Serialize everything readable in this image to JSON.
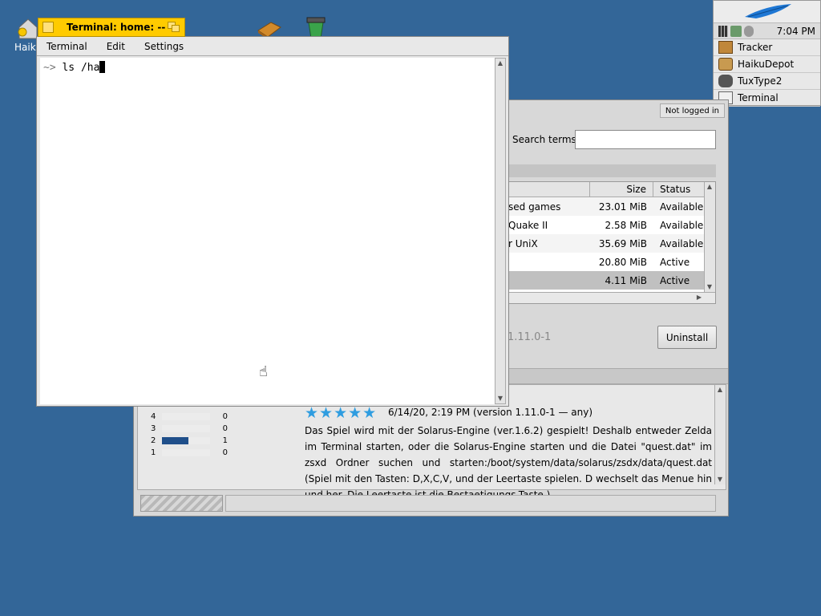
{
  "desktop": {
    "icons": [
      {
        "label": "Haiku"
      },
      {
        "label": ""
      },
      {
        "label": ""
      }
    ]
  },
  "deskbar": {
    "time": "7:04 PM",
    "apps": [
      {
        "label": "Tracker",
        "icon": "tracker-icon"
      },
      {
        "label": "HaikuDepot",
        "icon": "haikudepot-icon"
      },
      {
        "label": "TuxType2",
        "icon": "tuxtype-icon"
      },
      {
        "label": "Terminal",
        "icon": "terminal-icon"
      }
    ]
  },
  "depot": {
    "status": "Not logged in",
    "search_label": "Search terms:",
    "table": {
      "headers": {
        "size": "Size",
        "status": "Status"
      },
      "rows": [
        {
          "name": "sed games",
          "size": "23.01 MiB",
          "status": "Available"
        },
        {
          "name": " Quake II",
          "size": "2.58 MiB",
          "status": "Available"
        },
        {
          "name": "r UniX",
          "size": "35.69 MiB",
          "status": "Available"
        },
        {
          "name": "",
          "size": "20.80 MiB",
          "status": "Active"
        },
        {
          "name": "",
          "size": "4.11 MiB",
          "status": "Active"
        }
      ]
    },
    "version": "1.11.0-1",
    "uninstall_label": "Uninstall",
    "ratings": [
      {
        "stars": "4",
        "count": "0",
        "fraction": 0
      },
      {
        "stars": "3",
        "count": "0",
        "fraction": 0
      },
      {
        "stars": "2",
        "count": "1",
        "fraction": 0.55
      },
      {
        "stars": "1",
        "count": "0",
        "fraction": 0
      }
    ],
    "review": {
      "stars": "★★★★★",
      "date": "6/14/20, 2:19 PM (version 1.11.0-1 — any)",
      "text": "Das Spiel wird mit der Solarus-Engine (ver.1.6.2) gespielt! Deshalb entweder Zelda im Terminal starten, oder die Solarus-Engine starten und die Datei \"quest.dat\" im zsxd Ordner suchen und starten:/boot/system/data/solarus/zsdx/data/quest.dat (Spiel mit den Tasten: D,X,C,V, und der Leertaste spielen. D wechselt das Menue hin und her.  Die Leertaste ist die Bestaetigungs-Taste.)"
    }
  },
  "terminal": {
    "title": "Terminal: home: --",
    "menu": [
      "Terminal",
      "Edit",
      "Settings"
    ],
    "prompt": "~>",
    "command": " ls /ha"
  }
}
